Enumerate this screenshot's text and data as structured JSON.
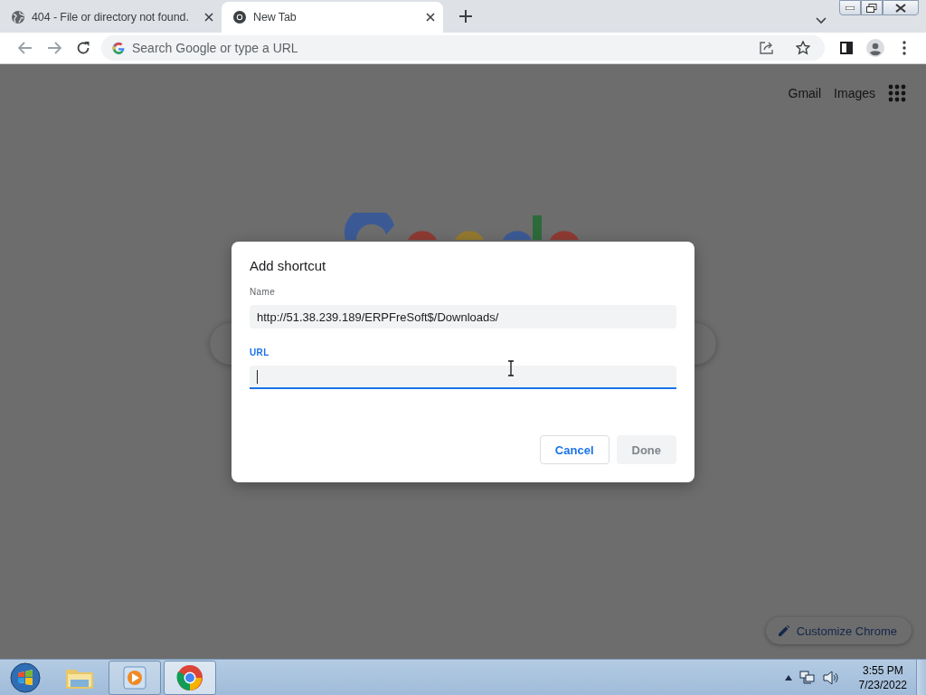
{
  "tabs": [
    {
      "title": "404 - File or directory not found.",
      "kind": "globe",
      "selected": false
    },
    {
      "title": "New Tab",
      "kind": "chrome",
      "selected": true
    }
  ],
  "toolbar": {
    "omnibox": {
      "placeholder": "Search Google or type a URL"
    }
  },
  "ntp": {
    "links": [
      "Gmail",
      "Images"
    ],
    "customize_button": "Customize Chrome"
  },
  "dialog": {
    "title": "Add shortcut",
    "fields": [
      {
        "label": "Name",
        "value": "http://51.38.239.189/ERPFreSoft$/Downloads/",
        "focused": false
      },
      {
        "label": "URL",
        "focused": true
      }
    ],
    "buttons": [
      {
        "label": "Cancel",
        "kind": "secondary",
        "disabled": false
      },
      {
        "label": "Done",
        "kind": "primary",
        "disabled": true
      }
    ]
  },
  "taskbar": {
    "apps": [
      {
        "kind": "folder",
        "running": false,
        "selected": false
      },
      {
        "kind": "media",
        "running": true,
        "selected": false
      },
      {
        "kind": "chrome",
        "running": true,
        "selected": true
      }
    ],
    "time": "3:55 PM",
    "date": "7/23/2022"
  }
}
